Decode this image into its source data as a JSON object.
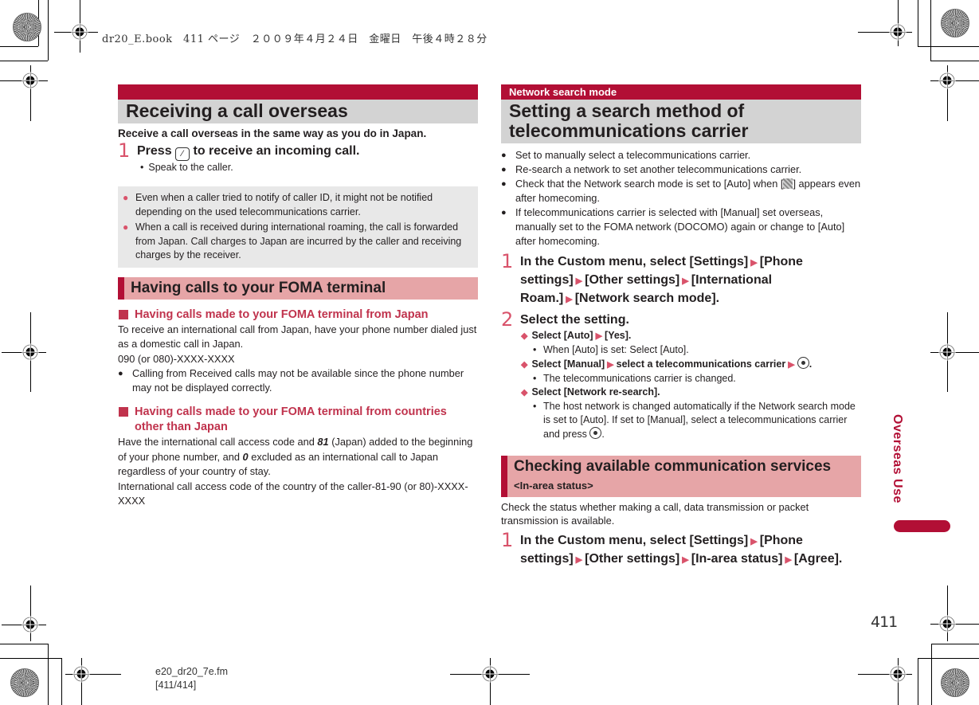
{
  "print_header": "dr20_E.book　411 ページ　２００９年４月２４日　金曜日　午後４時２８分",
  "left": {
    "section1": {
      "bar_label": "",
      "title": "Receiving a call overseas",
      "lead": "Receive a call overseas in the same way as you do in Japan.",
      "step1": {
        "num": "1",
        "pre": "Press",
        "key_icon": "call-key-icon",
        "post": "to receive an incoming call.",
        "note": "Speak to the caller."
      },
      "notes": [
        "Even when a caller tried to notify of caller ID, it might not be notified depending on the used telecommunications carrier.",
        "When a call is received during international roaming, the call is forwarded from Japan. Call charges to Japan are incurred by the caller and receiving charges by the receiver."
      ]
    },
    "section2": {
      "title": "Having calls to your FOMA terminal",
      "sub1": {
        "heading": "Having calls made to your FOMA terminal from Japan",
        "body1": "To receive an international call from Japan, have your phone number dialed just as a domestic call in Japan.",
        "body2": "090 (or 080)-XXXX-XXXX",
        "bullet": "Calling from Received calls may not be available since the phone number may not be displayed correctly."
      },
      "sub2": {
        "heading": "Having calls made to your FOMA terminal from countries other than Japan",
        "body_a": "Have the international call access code and ",
        "bold1": "81",
        "body_b": " (Japan) added to the beginning of your phone number, and ",
        "bold2": "0",
        "body_c": " excluded as an international call to Japan regardless of your country of stay.",
        "body2": "International call access code of the country of the caller-81-90 (or 80)-XXXX-XXXX"
      }
    }
  },
  "right": {
    "section1": {
      "bar_label": "Network search mode",
      "title": "Setting a search method of telecommunications carrier",
      "bullets": {
        "b1": "Set to manually select a telecommunications carrier.",
        "b2": "Re-search a network to set another telecommunications carrier.",
        "b3_pre": "Check that the Network search mode is set to [Auto] when [",
        "b3_icon": "roaming-status-icon",
        "b3_post": "] appears even after homecoming.",
        "b4": "If telecommunications carrier is selected with [Manual] set overseas, manually set to the FOMA network (DOCOMO) again or change to [Auto] after homecoming."
      },
      "step1": {
        "num": "1",
        "parts": [
          "In the Custom menu, select [Settings]",
          "[Phone settings]",
          "[Other settings]",
          "[International Roam.]",
          "[Network search mode]."
        ]
      },
      "step2": {
        "num": "2",
        "text": "Select the setting.",
        "opt1_a": "Select [Auto]",
        "opt1_b": "[Yes].",
        "opt1_note": "When [Auto] is set: Select [Auto].",
        "opt2_a": "Select [Manual]",
        "opt2_b": "select a telecommunications carrier",
        "opt2_c": ".",
        "opt2_note": "The telecommunications carrier is changed.",
        "opt3": "Select [Network re-search].",
        "opt3_note": "The host network is changed automatically if the Network search mode is set to [Auto]. If set to [Manual], select a telecommunications carrier and press",
        "opt3_note_end": "."
      }
    },
    "section2": {
      "title": "Checking available communication services",
      "subtitle": "<In-area status>",
      "body": "Check the status whether making a call, data transmission or packet transmission is available.",
      "step1": {
        "num": "1",
        "parts": [
          "In the Custom menu, select [Settings]",
          "[Phone settings]",
          "[Other settings]",
          "[In-area status]",
          "[Agree]."
        ]
      }
    }
  },
  "side_tab": "Overseas Use",
  "page_number": "411",
  "footer": {
    "file": "e20_dr20_7e.fm",
    "pages": "[411/414]"
  },
  "colors": {
    "brand": "#b20f35",
    "accent_pink": "#e6a5a7",
    "step_num": "#d9536b",
    "title_gray": "#d3d3d3",
    "note_gray": "#e8e8e8"
  }
}
